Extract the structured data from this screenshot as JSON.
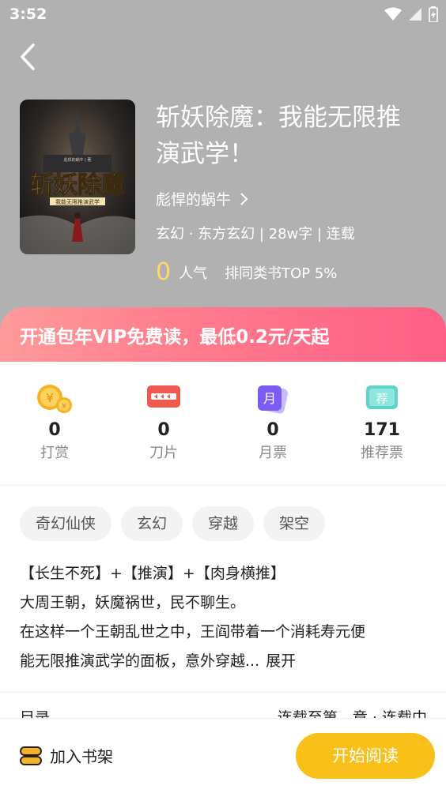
{
  "status_bar": {
    "time": "3:52"
  },
  "book": {
    "title": "斩妖除魔：我能无限推演武学！",
    "author": "彪悍的蜗牛",
    "meta": "玄幻 · 东方玄幻 | 28w字 | 连载",
    "popularity_value": "0",
    "popularity_label": "人气",
    "rank_text": "排同类书TOP 5%",
    "cover": {
      "big_title": "斩妖除魔",
      "subtitle": "我能无限推演武学",
      "author_small": "彪悍的蜗牛 | 著"
    }
  },
  "vip_banner": "开通包年VIP免费读，最低0.2元/天起",
  "stats": [
    {
      "value": "0",
      "label": "打赏",
      "icon": "coin-icon"
    },
    {
      "value": "0",
      "label": "刀片",
      "icon": "blade-icon"
    },
    {
      "value": "0",
      "label": "月票",
      "icon": "monthly-ticket-icon",
      "glyph": "月"
    },
    {
      "value": "171",
      "label": "推荐票",
      "icon": "recommend-ticket-icon",
      "glyph": "荐"
    }
  ],
  "tags": [
    "奇幻仙侠",
    "玄幻",
    "穿越",
    "架空"
  ],
  "description": {
    "line1": "【长生不死】+【推演】+【肉身横推】",
    "line2": "大周王朝，妖魔祸世，民不聊生。",
    "line3": "在这样一个王朝乱世之中，王阎带着一个消耗寿元便",
    "line4": "能无限推演武学的面板，意外穿越...",
    "expand": "展开"
  },
  "catalog_peek": {
    "left": "目录",
    "right": "连载至第…章 · 连载中"
  },
  "bottom_bar": {
    "add_shelf": "加入书架",
    "start_reading": "开始阅读"
  },
  "colors": {
    "header_bg": "#b1b1b1",
    "accent_yellow": "#f8c018",
    "banner_pink": "#ff5f86"
  }
}
